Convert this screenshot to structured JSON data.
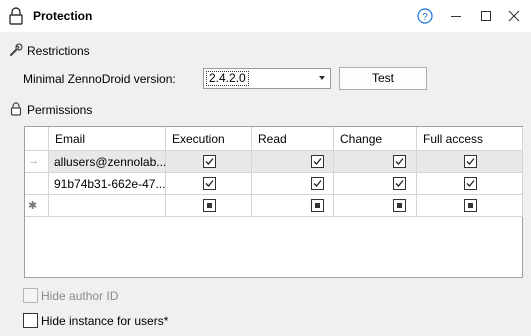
{
  "window": {
    "title": "Protection",
    "help_label": "?"
  },
  "restrictions": {
    "section_label": "Restrictions",
    "version_label": "Minimal ZennoDroid version:",
    "version_value": "2.4.2.0",
    "test_button": "Test"
  },
  "permissions": {
    "section_label": "Permissions",
    "columns": [
      "Email",
      "Execution",
      "Read",
      "Change",
      "Full access"
    ],
    "rows": [
      {
        "indicator": "→",
        "email": "allusers@zennolab....",
        "execution": true,
        "read": true,
        "change": true,
        "full_access": true,
        "selected": true
      },
      {
        "indicator": "",
        "email": "91b74b31-662e-47...",
        "execution": true,
        "read": true,
        "change": true,
        "full_access": true,
        "selected": false
      },
      {
        "indicator": "✱",
        "email": "",
        "execution": "indeterminate",
        "read": "indeterminate",
        "change": "indeterminate",
        "full_access": "indeterminate",
        "selected": false
      }
    ]
  },
  "options": {
    "hide_author_id": {
      "label": "Hide author ID",
      "checked": false,
      "enabled": false
    },
    "hide_instance": {
      "label": "Hide instance for users*",
      "checked": false,
      "enabled": true
    }
  }
}
